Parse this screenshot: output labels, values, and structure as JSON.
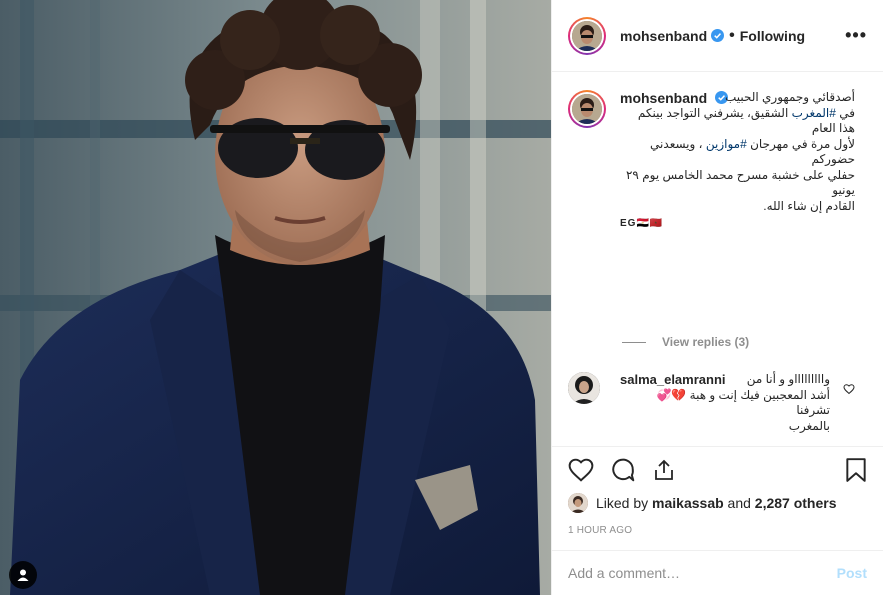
{
  "post": {
    "username": "mohsenband",
    "follow_status": "Following",
    "more_icon": "more-dots-icon",
    "verified_icon": "verified-badge-icon"
  },
  "caption": {
    "username": "mohsenband",
    "line1": "أصدقائي وجمهوري الحبيب",
    "line2_prefix": "في ",
    "hashtag1": "#المغرب",
    "line2_suffix": " الشقيق، يشرفني التواجد بينكم هذا العام",
    "line3_prefix": "لأول مرة في مهرجان ",
    "hashtag2": "#موازين",
    "line3_suffix": " ، ويسعدني حضوركم",
    "line4": "حفلي على خشبة مسرح محمد الخامس يوم ٢٩ يونيو",
    "line5": "القادم إن شاء الله.",
    "flags": "EG🇪🇬🇲🇦"
  },
  "replies": {
    "label": "View replies (3)"
  },
  "comment": {
    "username": "salma_elamranni",
    "text_line1": "واااااااااو و أنا من",
    "text_line2": "أشد المعجبين فيك إنت و هبة 💔💞 تشرفنا",
    "text_line3": "بالمغرب"
  },
  "likes": {
    "prefix": "Liked by",
    "user": "maikassab",
    "and": "and",
    "others": "2,287 others"
  },
  "timestamp": "1 HOUR AGO",
  "add_comment": {
    "placeholder": "Add a comment…",
    "post_label": "Post"
  },
  "colors": {
    "hashtag": "#00376b",
    "verified": "#3897f0",
    "post_disabled": "#b2dffc",
    "muted": "#8e8e8e"
  }
}
